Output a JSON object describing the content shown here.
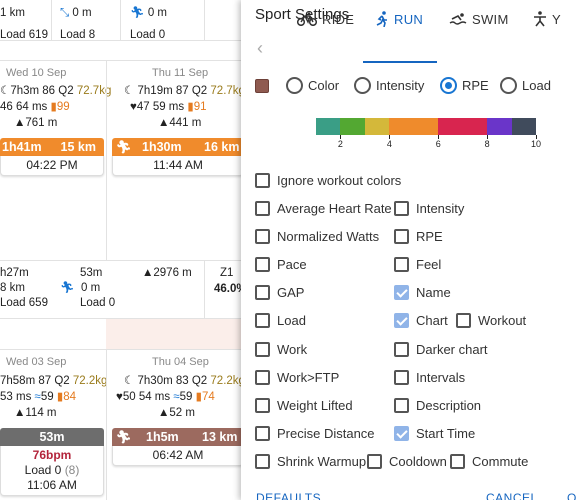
{
  "background": {
    "row1": {
      "c1": [
        "1 km",
        "Load 619"
      ],
      "c2": [
        "0 m",
        "Load 8"
      ],
      "c3": [
        "0 m",
        "Load 0"
      ]
    },
    "wed10": {
      "day": "Wed 10 Sep",
      "line1": "7h3m 86 Q2",
      "weight": "72.7kg",
      "line2": "46 64 ms",
      "fire": "99",
      "elev": "761 m",
      "bar_time": "1h41m",
      "bar_dist": "15 km",
      "time": "04:22 PM"
    },
    "thu11": {
      "day": "Thu 11 Sep",
      "line1": "7h19m 87 Q2",
      "weight": "72.7kg",
      "line2": "47 59 ms",
      "fire": "91",
      "elev": "441 m",
      "bar_time": "1h30m",
      "bar_dist": "16 km",
      "time": "11:44 AM"
    },
    "summary": {
      "c1": [
        "h27m",
        "8 km",
        "Load 659"
      ],
      "c2": [
        "53m",
        "0 m",
        "Load 0"
      ],
      "elev": "2976 m",
      "z1": "Z1",
      "pct": "46.0%"
    },
    "wed03": {
      "day": "Wed 03 Sep",
      "line1": "7h58m 87 Q2",
      "weight": "72.2kg",
      "line2": "53 ms",
      "hrv": "59",
      "fire": "84",
      "elev": "114 m",
      "bar_time": "53m",
      "bpm": "76bpm",
      "load": "Load 0",
      "load_paren": "(8)",
      "time": "11:06 AM"
    },
    "thu04": {
      "day": "Thu 04 Sep",
      "line1": "7h30m 83 Q2",
      "weight": "72.2kg",
      "line2": "50 54 ms",
      "hrv": "59",
      "fire": "74",
      "elev": "52 m",
      "bar_time": "1h5m",
      "bar_dist": "13 km",
      "time": "06:42 AM"
    }
  },
  "dialog": {
    "title": "Sport Settings",
    "tabs": [
      {
        "label": "RIDE"
      },
      {
        "label": "RUN",
        "active": true
      },
      {
        "label": "SWIM"
      },
      {
        "label": "Y"
      }
    ],
    "swatch_color": "#8f5a50",
    "color_modes": [
      {
        "label": "Color",
        "selected": false
      },
      {
        "label": "Intensity",
        "selected": false
      },
      {
        "label": "RPE",
        "selected": true
      },
      {
        "label": "Load",
        "selected": false
      }
    ],
    "scale_colors": [
      "#3a9e86",
      "#53a832",
      "#d4b83a",
      "#ef8b2c",
      "#ef8b2c",
      "#d8254f",
      "#d8254f",
      "#6a35c9",
      "#404b5c"
    ],
    "scale_ticks": [
      "2",
      "4",
      "6",
      "8",
      "10"
    ],
    "options": {
      "ignore_colors": {
        "label": "Ignore workout colors",
        "checked": false
      },
      "avg_hr": {
        "label": "Average Heart Rate",
        "checked": false
      },
      "intensity": {
        "label": "Intensity",
        "checked": false
      },
      "norm_watts": {
        "label": "Normalized Watts",
        "checked": false
      },
      "rpe": {
        "label": "RPE",
        "checked": false
      },
      "pace": {
        "label": "Pace",
        "checked": false
      },
      "feel": {
        "label": "Feel",
        "checked": false
      },
      "gap": {
        "label": "GAP",
        "checked": false
      },
      "name": {
        "label": "Name",
        "checked": true
      },
      "load": {
        "label": "Load",
        "checked": false
      },
      "chart": {
        "label": "Chart",
        "checked": true
      },
      "workout": {
        "label": "Workout",
        "checked": false
      },
      "work": {
        "label": "Work",
        "checked": false
      },
      "darker_chart": {
        "label": "Darker chart",
        "checked": false
      },
      "work_ftp": {
        "label": "Work>FTP",
        "checked": false
      },
      "intervals": {
        "label": "Intervals",
        "checked": false
      },
      "weight_lifted": {
        "label": "Weight Lifted",
        "checked": false
      },
      "description": {
        "label": "Description",
        "checked": false
      },
      "precise_distance": {
        "label": "Precise Distance",
        "checked": false
      },
      "start_time": {
        "label": "Start Time",
        "checked": true
      },
      "shrink_warmup": {
        "label": "Shrink Warmup",
        "checked": false
      },
      "cooldown": {
        "label": "Cooldown",
        "checked": false
      },
      "commute": {
        "label": "Commute",
        "checked": false
      }
    },
    "footer": {
      "defaults": "DEFAULTS",
      "cancel": "CANCEL",
      "ok": "O"
    }
  }
}
